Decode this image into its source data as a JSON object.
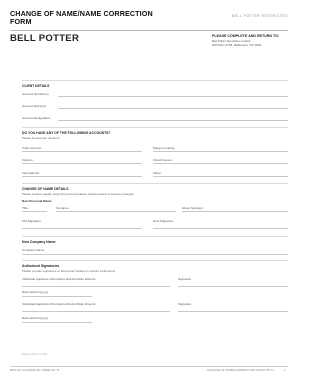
{
  "header": {
    "title_line1": "CHANGE OF NAME/NAME CORRECTION",
    "title_line2": "FORM",
    "restricted": "BELL POTTER RESTRICTED",
    "logo": "BELL POTTER",
    "return_title_line1": "PLEASE COMPLETE AND RETURN TO:",
    "return_lines": [
      "Bell Potter Securities Limited",
      "GPO Box 4718, Melbourne VIC 3001"
    ]
  },
  "client_details": {
    "heading": "CLIENT DETAILS",
    "fields": [
      "Account Number(s)",
      "Account Name(s)",
      "Account Designation"
    ]
  },
  "accounts": {
    "heading": "DO YOU HAVE ANY OF THE FOLLOWING ACCOUNTS?",
    "subheading": "Please list account numbers",
    "left": [
      "Cash Account",
      "Options",
      "International"
    ],
    "right": [
      "Margin Lending",
      "Fixed Interest",
      "Other"
    ]
  },
  "name_details": {
    "heading": "CHANGE OF NAME DETAILS",
    "subheading": "Please enclose legally supporting documentation outlined below to process changes",
    "new_personal_name": "New Personal Name",
    "cols": [
      "Title",
      "Surname",
      "Given Name(s)"
    ],
    "old_signature": "Old Signature",
    "new_signature": "New Signature"
  },
  "company": {
    "heading": "New Company Name",
    "field": "Company Name"
  },
  "authorised": {
    "heading": "Authorised Signatories",
    "subheading": "Please provide signatures of all account holders to ensure instructions",
    "applicant1": "Individual Applicant 1/Company Director/Sole Director",
    "applicant2": "Individual Applicant 2/Company Director/Sole Director",
    "signature": "Signature",
    "date": "Date (dd/mm/yyyy)"
  },
  "faint_text": "Please list in order",
  "footer": {
    "left": "BPS-NC-CHANGE-OF-NAME-PP-T1",
    "right": "CHANGE OF NAME/CORRECTION FORM PP T1",
    "page": "1"
  }
}
